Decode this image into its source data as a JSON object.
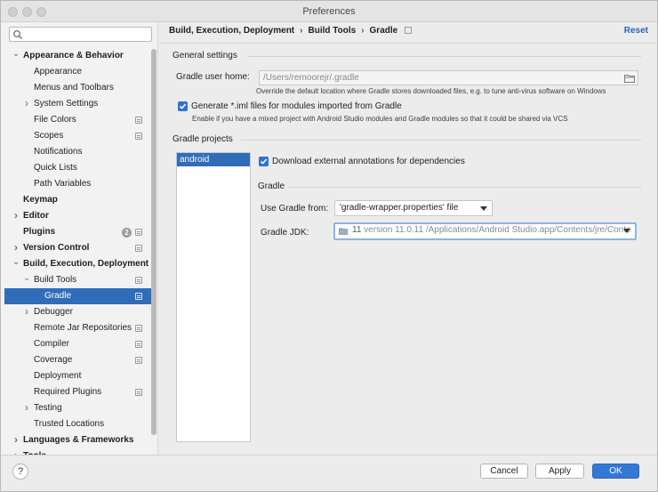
{
  "window": {
    "title": "Preferences"
  },
  "search": {
    "placeholder": "",
    "value": ""
  },
  "sidebar": {
    "items": [
      {
        "label": "Appearance & Behavior",
        "level": 0,
        "arrow": "expanded",
        "bold": true
      },
      {
        "label": "Appearance",
        "level": 1,
        "arrow": "none"
      },
      {
        "label": "Menus and Toolbars",
        "level": 1,
        "arrow": "none"
      },
      {
        "label": "System Settings",
        "level": 1,
        "arrow": "collapsed"
      },
      {
        "label": "File Colors",
        "level": 1,
        "arrow": "none",
        "project_icon": true
      },
      {
        "label": "Scopes",
        "level": 1,
        "arrow": "none",
        "project_icon": true
      },
      {
        "label": "Notifications",
        "level": 1,
        "arrow": "none"
      },
      {
        "label": "Quick Lists",
        "level": 1,
        "arrow": "none"
      },
      {
        "label": "Path Variables",
        "level": 1,
        "arrow": "none"
      },
      {
        "label": "Keymap",
        "level": 0,
        "arrow": "none",
        "bold": true
      },
      {
        "label": "Editor",
        "level": 0,
        "arrow": "collapsed",
        "bold": true
      },
      {
        "label": "Plugins",
        "level": 0,
        "arrow": "none",
        "bold": true,
        "badge": "2",
        "project_icon": true
      },
      {
        "label": "Version Control",
        "level": 0,
        "arrow": "collapsed",
        "bold": true,
        "project_icon": true
      },
      {
        "label": "Build, Execution, Deployment",
        "level": 0,
        "arrow": "expanded",
        "bold": true
      },
      {
        "label": "Build Tools",
        "level": 1,
        "arrow": "expanded",
        "project_icon": true
      },
      {
        "label": "Gradle",
        "level": 2,
        "arrow": "none",
        "selected": true,
        "project_icon": true
      },
      {
        "label": "Debugger",
        "level": 1,
        "arrow": "collapsed"
      },
      {
        "label": "Remote Jar Repositories",
        "level": 1,
        "arrow": "none",
        "project_icon": true
      },
      {
        "label": "Compiler",
        "level": 1,
        "arrow": "none",
        "project_icon": true
      },
      {
        "label": "Coverage",
        "level": 1,
        "arrow": "none",
        "project_icon": true
      },
      {
        "label": "Deployment",
        "level": 1,
        "arrow": "none"
      },
      {
        "label": "Required Plugins",
        "level": 1,
        "arrow": "none",
        "project_icon": true
      },
      {
        "label": "Testing",
        "level": 1,
        "arrow": "collapsed"
      },
      {
        "label": "Trusted Locations",
        "level": 1,
        "arrow": "none"
      },
      {
        "label": "Languages & Frameworks",
        "level": 0,
        "arrow": "collapsed",
        "bold": true
      },
      {
        "label": "Tools",
        "level": 0,
        "arrow": "collapsed",
        "bold": true
      }
    ]
  },
  "header": {
    "breadcrumb": [
      "Build, Execution, Deployment",
      "Build Tools",
      "Gradle"
    ],
    "reset_label": "Reset"
  },
  "general": {
    "title": "General settings",
    "user_home_label": "Gradle user home:",
    "user_home_value": "/Users/remoorejr/.gradle",
    "user_home_hint": "Override the default location where Gradle stores downloaded files, e.g. to tune anti-virus software on Windows",
    "generate_iml_label": "Generate *.iml files for modules imported from Gradle",
    "generate_iml_checked": true,
    "generate_iml_hint": "Enable if you have a mixed project with Android Studio modules and Gradle modules so that it could be shared via VCS"
  },
  "projects": {
    "title": "Gradle projects",
    "items": [
      "android"
    ],
    "download_annotations_label": "Download external annotations for dependencies",
    "download_annotations_checked": true
  },
  "gradle": {
    "title": "Gradle",
    "use_from_label": "Use Gradle from:",
    "use_from_value": "'gradle-wrapper.properties' file",
    "jdk_label": "Gradle JDK:",
    "jdk_version": "11",
    "jdk_value": "version 11.0.11 /Applications/Android Studio.app/Contents/jre/Conte"
  },
  "footer": {
    "help_label": "?",
    "cancel_label": "Cancel",
    "apply_label": "Apply",
    "ok_label": "OK"
  },
  "colors": {
    "accent": "#3478d4",
    "selection": "#2f6db9",
    "link": "#2a64b8"
  }
}
